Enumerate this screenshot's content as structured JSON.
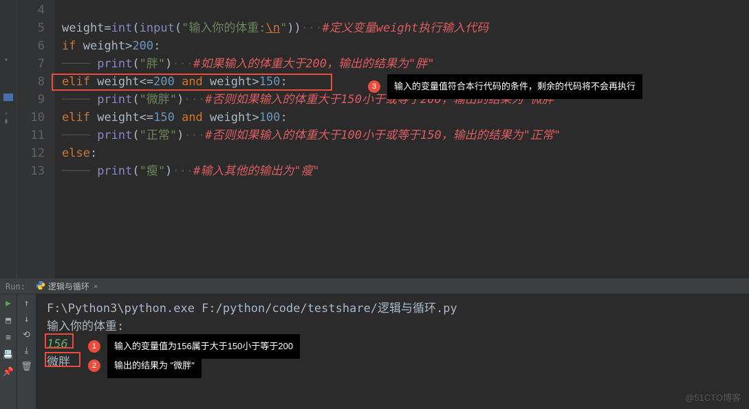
{
  "editor": {
    "lines": [
      4,
      5,
      6,
      7,
      8,
      9,
      10,
      11,
      12,
      13
    ],
    "code": {
      "l5_var": "weight",
      "l5_eq": "=",
      "l5_int": "int",
      "l5_input": "input",
      "l5_str1": "\"",
      "l5_str2": "输入你的体重:",
      "l5_esc": "\\n",
      "l5_str3": "\"",
      "l5_comment": "#定义变量weight执行输入代码",
      "l6_if": "if",
      "l6_var": "weight",
      "l6_gt": ">",
      "l6_num": "200",
      "l7_print": "print",
      "l7_str": "\"胖\"",
      "l7_comment": "#如果输入的体重大于200，输出的结果为\"胖\"",
      "l8_elif": "elif",
      "l8_var1": "weight",
      "l8_le": "<=",
      "l8_num1": "200",
      "l8_and": "and",
      "l8_var2": "weight",
      "l8_gt": ">",
      "l8_num2": "150",
      "l9_print": "print",
      "l9_str": "\"微胖\"",
      "l9_comment": "#否则如果输入的体重大于150小于或等于200，输出的结果为\"微胖\"",
      "l10_elif": "elif",
      "l10_var1": "weight",
      "l10_le": "<=",
      "l10_num1": "150",
      "l10_and": "and",
      "l10_var2": "weight",
      "l10_gt": ">",
      "l10_num2": "100",
      "l11_print": "print",
      "l11_str": "\"正常\"",
      "l11_comment": "#否则如果输入的体重大于100小于或等于150，输出的结果为\"正常\"",
      "l12_else": "else",
      "l13_print": "print",
      "l13_str": "\"瘦\"",
      "l13_comment": "#输入其他的输出为\"瘦\""
    }
  },
  "callouts": {
    "c1_num": "1",
    "c1_text": "输入的变量值为156属于大于150小于等于200",
    "c2_num": "2",
    "c2_text": "输出的结果为 \"微胖\"",
    "c3_num": "3",
    "c3_text": "输入的变量值符合本行代码的条件，剩余的代码将不会再执行"
  },
  "run": {
    "run_label": "Run:",
    "tab_name": "逻辑与循环",
    "output": {
      "path": "F:\\Python3\\python.exe F:/python/code/testshare/逻辑与循环.py",
      "prompt": "输入你的体重:",
      "input_val": "156",
      "result": "微胖"
    }
  },
  "watermark": "@51CTO博客"
}
